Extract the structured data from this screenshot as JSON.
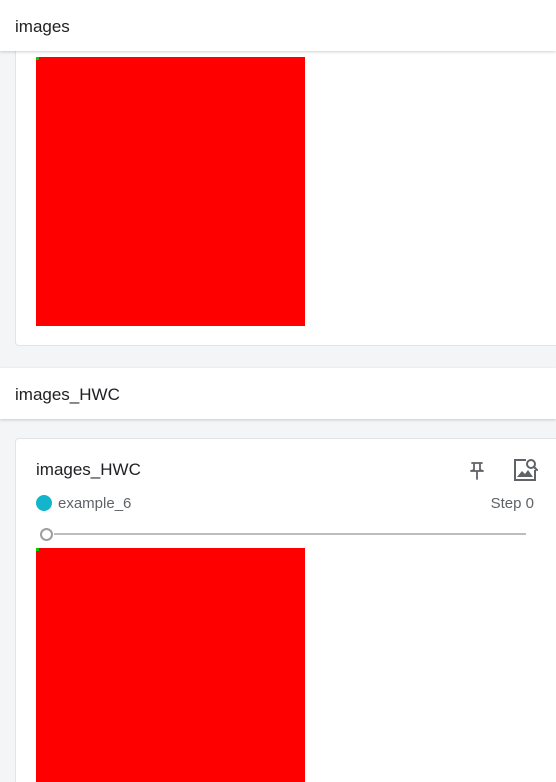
{
  "groups": [
    {
      "title": "images"
    },
    {
      "title": "images_HWC"
    }
  ],
  "card": {
    "title": "images_HWC",
    "run": {
      "name": "example_6",
      "color": "#12b5cb"
    },
    "step_label": "Step 0",
    "slider_value": 0,
    "icons": [
      "pin-icon",
      "image-search-icon"
    ]
  },
  "image_colors": {
    "fill": "#ff0000",
    "corner_pixel": "#00cc00"
  }
}
